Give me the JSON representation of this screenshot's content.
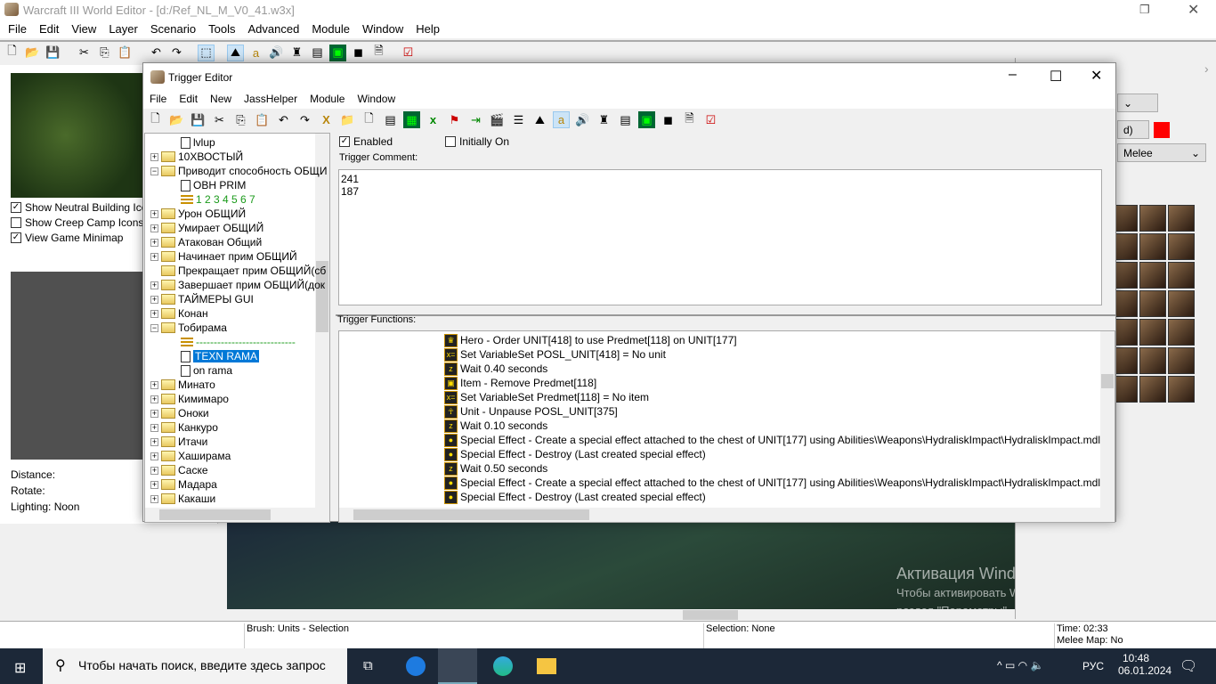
{
  "app": {
    "title": "Warcraft III World Editor - [d:/Ref_NL_M_V0_41.w3x]",
    "menu": [
      "File",
      "Edit",
      "View",
      "Layer",
      "Scenario",
      "Tools",
      "Advanced",
      "Module",
      "Window",
      "Help"
    ]
  },
  "left": {
    "checks": [
      {
        "label": "Show Neutral Building Icons",
        "checked": true
      },
      {
        "label": "Show Creep Camp Icons",
        "checked": false
      },
      {
        "label": "View Game Minimap",
        "checked": true
      }
    ],
    "distance": "Distance:",
    "rotate": "Rotate:",
    "lighting": "Lighting: Noon"
  },
  "palette": {
    "player_suffix": "d)",
    "player_color": "#ff0000",
    "tileset": "Melee"
  },
  "status": {
    "brush": "Brush: Units - Selection",
    "selection": "Selection: None",
    "time": "Time: 02:33",
    "melee": "Melee Map: No"
  },
  "watermark": {
    "line1": "Активация Windows",
    "line2": "Чтобы активировать Windows, перейдите в",
    "line3": "раздел \"Параметры\"."
  },
  "taskbar": {
    "search": "Чтобы начать поиск, введите здесь запрос",
    "time": "10:48",
    "date": "06.01.2024",
    "lang": "РУС"
  },
  "trigger_editor": {
    "title": "Trigger Editor",
    "menu": [
      "File",
      "Edit",
      "New",
      "JassHelper",
      "Module",
      "Window"
    ],
    "enabled_label": "Enabled",
    "enabled": true,
    "initially_on_label": "Initially On",
    "initially_on": false,
    "comment_label": "Trigger Comment:",
    "comment": "241\n187",
    "functions_label": "Trigger Functions:",
    "tree": [
      {
        "label": "lvlup",
        "type": "page",
        "level": 2
      },
      {
        "label": "10ХВОСТЫЙ",
        "type": "folder",
        "level": 1
      },
      {
        "label": "Приводит способность ОБЩИ",
        "type": "folder",
        "level": 1,
        "open": true
      },
      {
        "label": "OBH PRIM",
        "type": "page",
        "level": 2
      },
      {
        "label": "1 2 3 4 5 6 7",
        "type": "comment",
        "level": 2
      },
      {
        "label": "Урон ОБЩИЙ",
        "type": "folder",
        "level": 1
      },
      {
        "label": "Умирает ОБЩИЙ",
        "type": "folder",
        "level": 1
      },
      {
        "label": "Атакован Общий",
        "type": "folder",
        "level": 1
      },
      {
        "label": "Начинает прим ОБЩИЙ",
        "type": "folder",
        "level": 1
      },
      {
        "label": "Прекращает прим ОБЩИЙ(сб",
        "type": "folder",
        "level": 1,
        "noplus": true
      },
      {
        "label": "Завершает прим ОБЩИЙ(док",
        "type": "folder",
        "level": 1
      },
      {
        "label": "ТАЙМЕРЫ GUI",
        "type": "folder",
        "level": 1
      },
      {
        "label": "Конан",
        "type": "folder",
        "level": 1
      },
      {
        "label": "Тобирама",
        "type": "folder",
        "level": 1,
        "open": true
      },
      {
        "label": "----------------------------",
        "type": "comment",
        "level": 2
      },
      {
        "label": "TEXN RAMA",
        "type": "page",
        "level": 2,
        "selected": true
      },
      {
        "label": "on rama",
        "type": "page",
        "level": 2
      },
      {
        "label": "Минато",
        "type": "folder",
        "level": 1
      },
      {
        "label": "Кимимаро",
        "type": "folder",
        "level": 1
      },
      {
        "label": "Оноки",
        "type": "folder",
        "level": 1
      },
      {
        "label": "Канкуро",
        "type": "folder",
        "level": 1
      },
      {
        "label": "Итачи",
        "type": "folder",
        "level": 1
      },
      {
        "label": "Хаширама",
        "type": "folder",
        "level": 1
      },
      {
        "label": "Саске",
        "type": "folder",
        "level": 1
      },
      {
        "label": "Мадара",
        "type": "folder",
        "level": 1
      },
      {
        "label": "Какаши",
        "type": "folder",
        "level": 1
      }
    ],
    "functions": [
      {
        "text": "Hero - Order UNIT[418] to use Predmet[118] on UNIT[177]",
        "icon": "hero-icon"
      },
      {
        "text": "Set VariableSet POSL_UNIT[418] = No unit",
        "icon": "set-variable-icon"
      },
      {
        "text": "Wait 0.40 seconds",
        "icon": "wait-icon"
      },
      {
        "text": "Item - Remove Predmet[118]",
        "icon": "item-icon"
      },
      {
        "text": "Set VariableSet Predmet[118] = No item",
        "icon": "set-variable-icon"
      },
      {
        "text": "Unit - Unpause POSL_UNIT[375]",
        "icon": "unit-icon"
      },
      {
        "text": "Wait 0.10 seconds",
        "icon": "wait-icon"
      },
      {
        "text": "Special Effect - Create a special effect attached to the chest of UNIT[177] using Abilities\\Weapons\\HydraliskImpact\\HydraliskImpact.mdl",
        "icon": "special-effect-icon"
      },
      {
        "text": "Special Effect - Destroy (Last created special effect)",
        "icon": "special-effect-icon"
      },
      {
        "text": "Wait 0.50 seconds",
        "icon": "wait-icon"
      },
      {
        "text": "Special Effect - Create a special effect attached to the chest of UNIT[177] using Abilities\\Weapons\\HydraliskImpact\\HydraliskImpact.mdl",
        "icon": "special-effect-icon"
      },
      {
        "text": "Special Effect - Destroy (Last created special effect)",
        "icon": "special-effect-icon"
      }
    ]
  }
}
